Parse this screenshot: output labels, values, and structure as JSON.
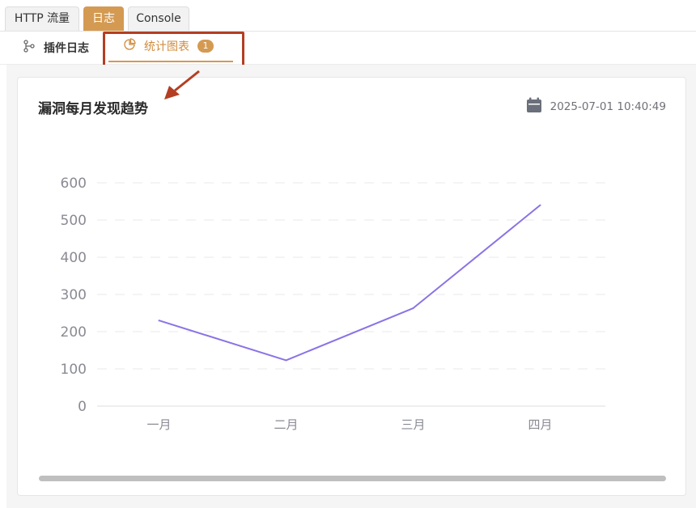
{
  "top_tabs": [
    {
      "label": "HTTP 流量",
      "active": false
    },
    {
      "label": "日志",
      "active": true
    },
    {
      "label": "Console",
      "active": false
    }
  ],
  "sub_tabs": {
    "plugin_log": {
      "label": "插件日志",
      "icon": "git-branch-icon"
    },
    "stats_chart": {
      "label": "统计图表",
      "icon": "pie-chart-icon",
      "badge": "1"
    }
  },
  "card": {
    "title": "漏洞每月发现趋势",
    "timestamp": "2025-07-01 10:40:49",
    "timestamp_icon": "calendar-icon"
  },
  "colors": {
    "accent": "#d49a52",
    "annotation": "#b43e23",
    "series": "#8b73e6"
  },
  "chart_data": {
    "type": "line",
    "categories": [
      "一月",
      "二月",
      "三月",
      "四月"
    ],
    "series": [
      {
        "values": [
          230,
          123,
          263,
          540
        ]
      }
    ],
    "yticks": [
      "0",
      "100",
      "200",
      "300",
      "400",
      "500",
      "600"
    ],
    "ylim": [
      0,
      600
    ],
    "title": "",
    "xlabel": "",
    "ylabel": "",
    "grid": true
  }
}
